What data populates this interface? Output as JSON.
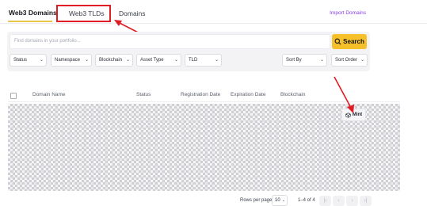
{
  "tabs": {
    "web3_domains": "Web3 Domains",
    "web3_tlds": "Web3 TLDs",
    "domains": "Domains"
  },
  "import_link": "Import Domains",
  "search": {
    "placeholder": "Find domains in your portfolio...",
    "button_label": "Search"
  },
  "filters": {
    "status": "Status",
    "namespace": "Namespace",
    "blockchain": "Blockchain",
    "asset_type": "Asset Type",
    "tld": "TLD",
    "sort_by": "Sort By",
    "sort_order": "Sort Order"
  },
  "table": {
    "columns": [
      "Domain Name",
      "Status",
      "Registration Date",
      "Expiration Date",
      "Blockchain"
    ],
    "mint_label": "Mint"
  },
  "pagination": {
    "rows_per_page_label": "Rows per page:",
    "rows_per_page_value": "10",
    "range": "1–4 of 4",
    "first": "|‹",
    "prev": "‹",
    "next": "›",
    "last": "›|"
  },
  "colors": {
    "accent_yellow": "#f5c02a",
    "tab_underline": "#e8c547",
    "link_purple": "#8b3ee8",
    "annotation_red": "#e01c24"
  }
}
